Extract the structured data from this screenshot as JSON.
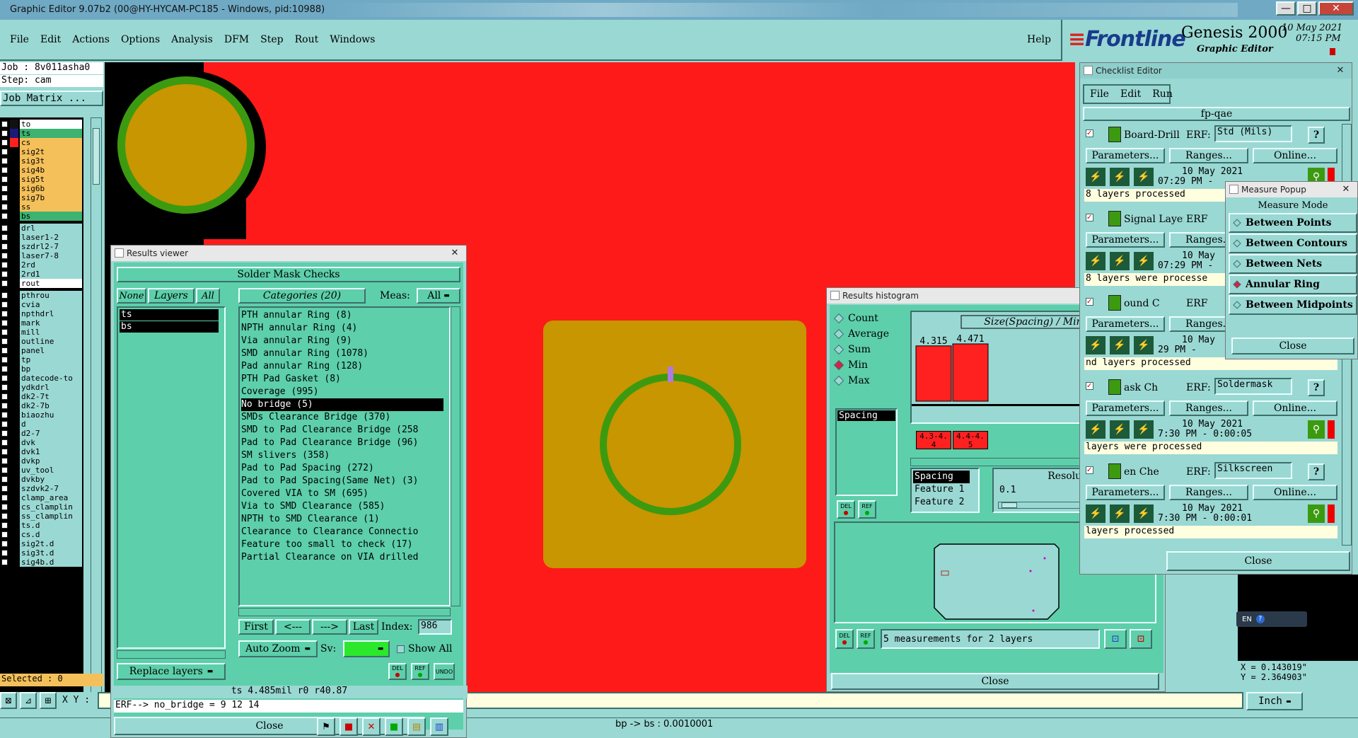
{
  "titlebar": {
    "title": "Graphic Editor 9.07b2 (00@HY-HYCAM-PC185 - Windows, pid:10988)",
    "min": "—",
    "max": "□",
    "close": "✕"
  },
  "menu": {
    "items": [
      "File",
      "Edit",
      "Actions",
      "Options",
      "Analysis",
      "DFM",
      "Step",
      "Rout",
      "Windows"
    ],
    "help": "Help"
  },
  "brand": {
    "logo": "Frontline",
    "product": "Genesis 2000",
    "subtitle": "Graphic Editor",
    "date": "10 May 2021",
    "time": "07:15 PM"
  },
  "info": {
    "job": "Job : 8v011asha0",
    "step": "Step: cam",
    "job_matrix": "Job Matrix ..."
  },
  "layers": [
    {
      "name": "to",
      "swatch": "#111111",
      "bg": "#ffffff"
    },
    {
      "name": "ts",
      "swatch": "#1a1a7a",
      "bg": "#3cb371"
    },
    {
      "name": "cs",
      "swatch": "#ff2020",
      "bg": "#f4c05a"
    },
    {
      "name": "sig2t",
      "swatch": "",
      "bg": "#f4c05a"
    },
    {
      "name": "sig3t",
      "swatch": "",
      "bg": "#f4c05a"
    },
    {
      "name": "sig4b",
      "swatch": "",
      "bg": "#f4c05a"
    },
    {
      "name": "sig5t",
      "swatch": "",
      "bg": "#f4c05a"
    },
    {
      "name": "sig6b",
      "swatch": "",
      "bg": "#f4c05a"
    },
    {
      "name": "sig7b",
      "swatch": "",
      "bg": "#f4c05a"
    },
    {
      "name": "ss",
      "swatch": "",
      "bg": "#f4c05a"
    },
    {
      "name": "bs",
      "swatch": "",
      "bg": "#3cb371"
    },
    {
      "name": "drl",
      "swatch": "",
      "bg": "#9ad8d3"
    },
    {
      "name": "laser1-2",
      "swatch": "",
      "bg": "#9ad8d3"
    },
    {
      "name": "szdrl2-7",
      "swatch": "",
      "bg": "#9ad8d3"
    },
    {
      "name": "laser7-8",
      "swatch": "",
      "bg": "#9ad8d3"
    },
    {
      "name": "2rd",
      "swatch": "",
      "bg": "#9ad8d3"
    },
    {
      "name": "2rd1",
      "swatch": "",
      "bg": "#9ad8d3"
    },
    {
      "name": "rout",
      "swatch": "",
      "bg": "#ffffff"
    },
    {
      "name": "pthrou",
      "swatch": "",
      "bg": "#9ad8d3"
    },
    {
      "name": "cvia",
      "swatch": "",
      "bg": "#9ad8d3"
    },
    {
      "name": "npthdrl",
      "swatch": "",
      "bg": "#9ad8d3"
    },
    {
      "name": "mark",
      "swatch": "",
      "bg": "#9ad8d3"
    },
    {
      "name": "mill",
      "swatch": "",
      "bg": "#9ad8d3"
    },
    {
      "name": "outline",
      "swatch": "",
      "bg": "#9ad8d3"
    },
    {
      "name": "panel",
      "swatch": "",
      "bg": "#9ad8d3"
    },
    {
      "name": "tp",
      "swatch": "",
      "bg": "#9ad8d3"
    },
    {
      "name": "bp",
      "swatch": "",
      "bg": "#9ad8d3"
    },
    {
      "name": "datecode-to",
      "swatch": "",
      "bg": "#9ad8d3"
    },
    {
      "name": "ydkdrl",
      "swatch": "",
      "bg": "#9ad8d3"
    },
    {
      "name": "dk2-7t",
      "swatch": "",
      "bg": "#9ad8d3"
    },
    {
      "name": "dk2-7b",
      "swatch": "",
      "bg": "#9ad8d3"
    },
    {
      "name": "biaozhu",
      "swatch": "",
      "bg": "#9ad8d3"
    },
    {
      "name": "d",
      "swatch": "",
      "bg": "#9ad8d3"
    },
    {
      "name": "d2-7",
      "swatch": "",
      "bg": "#9ad8d3"
    },
    {
      "name": "dvk",
      "swatch": "",
      "bg": "#9ad8d3"
    },
    {
      "name": "dvk1",
      "swatch": "",
      "bg": "#9ad8d3"
    },
    {
      "name": "dvkp",
      "swatch": "",
      "bg": "#9ad8d3"
    },
    {
      "name": "uv_tool",
      "swatch": "",
      "bg": "#9ad8d3"
    },
    {
      "name": "dvkby",
      "swatch": "",
      "bg": "#9ad8d3"
    },
    {
      "name": "szdvk2-7",
      "swatch": "",
      "bg": "#9ad8d3"
    },
    {
      "name": "clamp_area",
      "swatch": "",
      "bg": "#9ad8d3"
    },
    {
      "name": "cs_clamplin",
      "swatch": "",
      "bg": "#9ad8d3"
    },
    {
      "name": "ss_clamplin",
      "swatch": "",
      "bg": "#9ad8d3"
    },
    {
      "name": "ts.d",
      "swatch": "",
      "bg": "#9ad8d3"
    },
    {
      "name": "cs.d",
      "swatch": "",
      "bg": "#9ad8d3"
    },
    {
      "name": "sig2t.d",
      "swatch": "",
      "bg": "#9ad8d3"
    },
    {
      "name": "sig3t.d",
      "swatch": "",
      "bg": "#9ad8d3"
    },
    {
      "name": "sig4b.d",
      "swatch": "",
      "bg": "#9ad8d3"
    }
  ],
  "selected": "Selected : 0",
  "xy_label": "X Y :",
  "status": {
    "bottom": "bp -> bs : 0.0010001",
    "coords_x": "X = 0.143019\"",
    "coords_y": "Y = 2.364903\"",
    "units": "Inch"
  },
  "results_viewer": {
    "title": "Results viewer",
    "header": "Solder Mask Checks",
    "none": "None",
    "layers": "Layers",
    "all": "All",
    "categories_label": "Categories (20)",
    "meas_label": "Meas:",
    "meas_value": "All",
    "layer_list": [
      "ts",
      "bs"
    ],
    "categories": [
      "PTH annular Ring (8)",
      "NPTH annular Ring (4)",
      "Via annular Ring (9)",
      "SMD annular Ring (1078)",
      "Pad annular Ring (128)",
      "PTH Pad Gasket (8)",
      "Coverage (995)",
      "No bridge (5)",
      "SMDs Clearance Bridge (370)",
      "SMD to Pad Clearance Bridge (258",
      "Pad to Pad Clearance Bridge (96)",
      "SM slivers (358)",
      "Pad to Pad Spacing (272)",
      "Pad to Pad Spacing(Same Net) (3)",
      "Covered VIA to SM (695)",
      "Via to SMD Clearance (585)",
      "NPTH to SMD Clearance (1)",
      "Clearance to Clearance Connectio",
      "Feature too small to check (17)",
      "Partial Clearance on VIA drilled"
    ],
    "selected_category": "No bridge (5)",
    "first": "First",
    "prev": "<---",
    "next": "--->",
    "last": "Last",
    "index_label": "Index:",
    "index_value": "986",
    "auto_zoom": "Auto Zoom",
    "sv": "Sv:",
    "show_all": "Show All",
    "replace_layers": "Replace layers",
    "del": "DEL",
    "ref": "REF",
    "undo": "UNDO",
    "info_line": "ts 4.485mil  r0  r40.87",
    "erf_line": "ERF--> no_bridge = 9 12 14",
    "close": "Close"
  },
  "histogram": {
    "title": "Results histogram",
    "options": [
      "Count",
      "Average",
      "Sum",
      "Min",
      "Max"
    ],
    "selected_option": "Min",
    "chart_title": "Size(Spacing) / Min(Spacing)",
    "list": [
      "Spacing"
    ],
    "resolution_label": "Resolution",
    "resolution_value": "0.1",
    "feature_list": [
      "Spacing",
      "Feature 1",
      "Feature 2"
    ],
    "measurements": "5 measurements for 2 layers",
    "close": "Close",
    "del": "DEL",
    "ref": "REF"
  },
  "chart_data": {
    "type": "bar",
    "categories": [
      "4.3-4.4",
      "4.4-4.5"
    ],
    "values": [
      4.315,
      4.471
    ],
    "title": "Size(Spacing) / Min(Spacing)",
    "xlabel": "",
    "ylabel": "",
    "color": "#ff2020"
  },
  "checklist": {
    "title": "Checklist Editor",
    "menu": [
      "File",
      "Edit",
      "Run"
    ],
    "name": "fp-qae",
    "checks": [
      {
        "name": "Board-Drill Che",
        "erf": "ERF:",
        "erf_value": "Std (Mils)",
        "date": "10 May 2021",
        "time": "07:29 PM -",
        "status": "8 layers processed"
      },
      {
        "name": "Signal Layer Ch",
        "erf": "ERF",
        "date": "10 May",
        "time": "07:29 PM -",
        "status": "8 layers were processe"
      },
      {
        "name": "ound C",
        "erf": "ERF",
        "date": "10 May",
        "time": "29 PM -",
        "status": "nd layers processed"
      },
      {
        "name": "ask Ch",
        "erf": "ERF:",
        "erf_value": "Soldermask",
        "date": "10 May 2021",
        "time": "7:30 PM - 0:00:05",
        "status": "layers were processed"
      },
      {
        "name": "en Che",
        "erf": "ERF:",
        "erf_value": "Silkscreen",
        "date": "10 May 2021",
        "time": "7:30 PM - 0:00:01",
        "status": "layers processed"
      }
    ],
    "parameters": "Parameters...",
    "ranges": "Ranges...",
    "online": "Online...",
    "close": "Close",
    "help": "?"
  },
  "measure": {
    "title": "Measure Popup",
    "mode_label": "Measure Mode",
    "modes": [
      "Between Points",
      "Between Contours",
      "Between Nets",
      "Annular Ring",
      "Between Midpoints"
    ],
    "selected": "Annular Ring",
    "close": "Close"
  },
  "lang": "EN"
}
